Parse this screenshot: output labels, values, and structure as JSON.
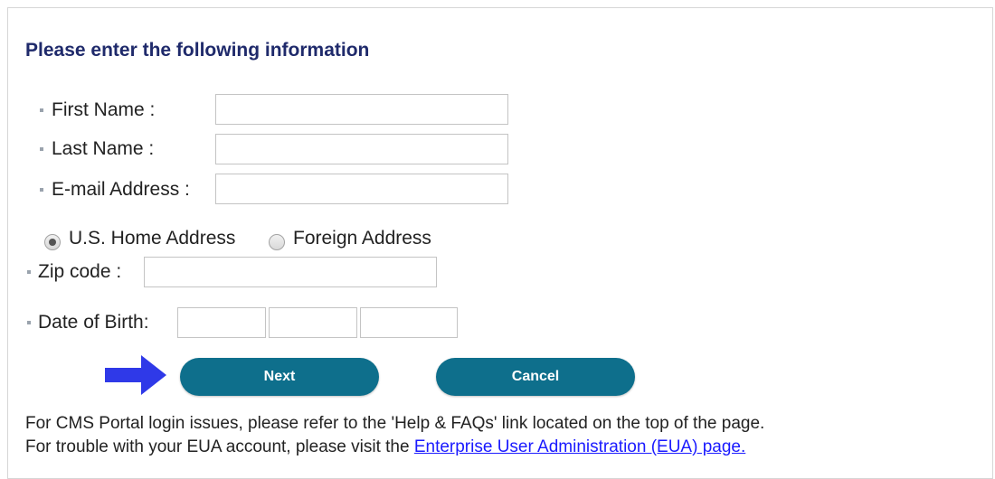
{
  "form": {
    "title": "Please enter the following information",
    "fields": {
      "first_name": {
        "label": "First Name :",
        "value": ""
      },
      "last_name": {
        "label": "Last Name :",
        "value": ""
      },
      "email": {
        "label": "E-mail Address :",
        "value": ""
      },
      "zip": {
        "label": "Zip code :",
        "value": ""
      },
      "dob": {
        "label": "Date of Birth:",
        "month": "",
        "day": "",
        "year": ""
      }
    },
    "address_type": {
      "options": [
        "U.S. Home Address",
        "Foreign Address"
      ],
      "selected": "U.S. Home Address"
    },
    "buttons": {
      "next": "Next",
      "cancel": "Cancel"
    },
    "arrow_icon": "right-arrow-icon",
    "colors": {
      "title": "#1f2a6b",
      "button": "#0e6f8c",
      "arrow": "#2f39e8",
      "link": "#1a1aff"
    }
  },
  "footer": {
    "line1": "For CMS Portal login issues, please refer to the 'Help & FAQs' link located on the top of the page.",
    "line2_prefix": "For trouble with your EUA account, please visit the ",
    "line2_link": "Enterprise User Administration (EUA) page."
  }
}
